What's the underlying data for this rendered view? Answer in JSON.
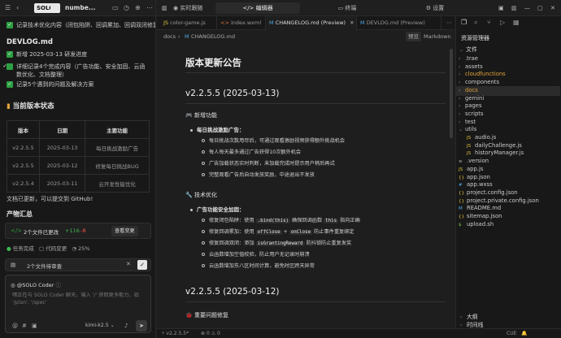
{
  "app": {
    "logo_text": "SOLO",
    "project_name": "numbe..."
  },
  "chat": {
    "top_item": "记录技术优化内容（闭包陷阱、回调累加、回调双闭修复）",
    "file_heading": "DEVLOG.md",
    "devlog_items": [
      "新增 2025-03-13 研发进度",
      "详细记录4个完成内容（广告功能、安全加固、云函数优化、文档整理）",
      "记录5个遇到的问题及解决方案"
    ],
    "version_status_heading": "当前版本状态",
    "version_table": {
      "headers": [
        "版本",
        "日期",
        "主要功能"
      ],
      "rows": [
        [
          "v2.2.5.5",
          "2025-03-13",
          "每日挑战激励广告"
        ],
        [
          "v2.2.5.5",
          "2025-03-12",
          "修复每日挑战BUG"
        ],
        [
          "v2.2.5.4",
          "2025-03-11",
          "云开发性能优化"
        ]
      ]
    },
    "doc_updated": "文档已更新，可以提交到 GitHub!",
    "product_summary": "产物汇总",
    "changes": {
      "label": "2个文件已更改",
      "added": "+116",
      "removed": "-8",
      "view_button": "查看变更"
    },
    "stats": {
      "task_done": "任务完成",
      "code_changes": "代码变更",
      "percent": "25%"
    },
    "pending_label": "2个文件待审查",
    "input": {
      "agent": "@SOLO Coder",
      "placeholder": "嘿正在与 SOLO Coder 聊天，输入 '/' 获取更多能力，如 '/plan', '/spec'",
      "model": "kimi-k2.5"
    }
  },
  "top_tabs": {
    "realtime": "实时跟随",
    "editor": "编辑器",
    "terminal": "终端",
    "settings": "设置"
  },
  "file_tabs": [
    {
      "name": "color-game.js",
      "icon": "JS"
    },
    {
      "name": "index.wxml",
      "icon": "<>"
    },
    {
      "name": "CHANGELOG.md (Preview)",
      "icon": "M"
    },
    {
      "name": "DEVLOG.md (Preview)",
      "icon": "M"
    }
  ],
  "breadcrumb": {
    "folder": "docs",
    "file": "CHANGELOG.md",
    "preview_btn": "预览",
    "markdown_btn": "Markdown"
  },
  "doc": {
    "title": "版本更新公告",
    "v1_heading": "v2.2.5.5 (2025-03-13)",
    "v1_new_feature": "新增功能",
    "v1_daily_ad": "每日挑战激励广告：",
    "v1_daily_items": [
      "每日挑战次数用尽后，可通过观看激励视频获得额外挑战机会",
      "每人每天最多通过广告获得10次额外机会",
      "广告加载状态实时判断，未加载完成时提示用户稍后再试",
      "完整观看广告后自动发放奖励，中途退出不发放"
    ],
    "tech_opt": "技术优化",
    "ad_security": "广告功能安全加固：",
    "sec_items": [
      {
        "pre": "修复闭包陷阱：使用 ",
        "code1": ".bind(this)",
        "mid": " 确保回调函数 ",
        "code2": "this",
        "post": " 指向正确"
      },
      {
        "pre": "修复回调累加：使用 ",
        "code1": "offClose",
        "mid": " + ",
        "code2": "onClose",
        "post": " 防止事件重复绑定"
      },
      {
        "pre": "修复回调双闭：添加 ",
        "code1": "isGrantingReward",
        "mid": "",
        "code2": "",
        "post": " 防抖锁防止重复发奖"
      },
      {
        "pre": "云函数增加空值校验，防止用户无记录时崩溃",
        "code1": "",
        "mid": "",
        "code2": "",
        "post": ""
      },
      {
        "pre": "云函数增加东八区时间计算，避免时区跨天异常",
        "code1": "",
        "mid": "",
        "code2": "",
        "post": ""
      }
    ],
    "v2_heading": "v2.2.5.5 (2025-03-12)",
    "v2_fix": "重要问题修复"
  },
  "explorer": {
    "title": "资源管理器",
    "section": "文件",
    "items": [
      {
        "label": ".trae",
        "type": "folder",
        "indent": 0
      },
      {
        "label": "assets",
        "type": "folder",
        "indent": 0
      },
      {
        "label": "cloudfunctions",
        "type": "folder",
        "indent": 0,
        "orange": true
      },
      {
        "label": "components",
        "type": "folder",
        "indent": 0
      },
      {
        "label": "docs",
        "type": "folder",
        "indent": 0,
        "selected": true
      },
      {
        "label": "gemini",
        "type": "folder",
        "indent": 0
      },
      {
        "label": "pages",
        "type": "folder",
        "indent": 0
      },
      {
        "label": "scripts",
        "type": "folder",
        "indent": 0
      },
      {
        "label": "test",
        "type": "folder",
        "indent": 0
      },
      {
        "label": "utils",
        "type": "folder-open",
        "indent": 0
      },
      {
        "label": "audio.js",
        "type": "js",
        "indent": 1
      },
      {
        "label": "dailyChallenge.js",
        "type": "js",
        "indent": 1
      },
      {
        "label": "historyManager.js",
        "type": "js",
        "indent": 1
      },
      {
        "label": ".version",
        "type": "file",
        "indent": 0
      },
      {
        "label": "app.js",
        "type": "js",
        "indent": 0
      },
      {
        "label": "app.json",
        "type": "json",
        "indent": 0
      },
      {
        "label": "app.wxss",
        "type": "css",
        "indent": 0
      },
      {
        "label": "project.config.json",
        "type": "json",
        "indent": 0
      },
      {
        "label": "project.private.config.json",
        "type": "json",
        "indent": 0
      },
      {
        "label": "README.md",
        "type": "md",
        "indent": 0
      },
      {
        "label": "sitemap.json",
        "type": "json",
        "indent": 0
      },
      {
        "label": "upload.sh",
        "type": "sh",
        "indent": 0
      }
    ],
    "outline": "大纲",
    "timeline": "时间线"
  },
  "status": {
    "branch": "v2.2.5.5*",
    "errors": "0",
    "warnings": "0",
    "position": "行 1, 列 1",
    "spaces": "空格: 4",
    "encoding": "UTF-8",
    "eol": "CUE"
  },
  "colors": {
    "accent": "#2ea043",
    "orange": "#e2a33c",
    "bg": "#1e1e1e"
  }
}
